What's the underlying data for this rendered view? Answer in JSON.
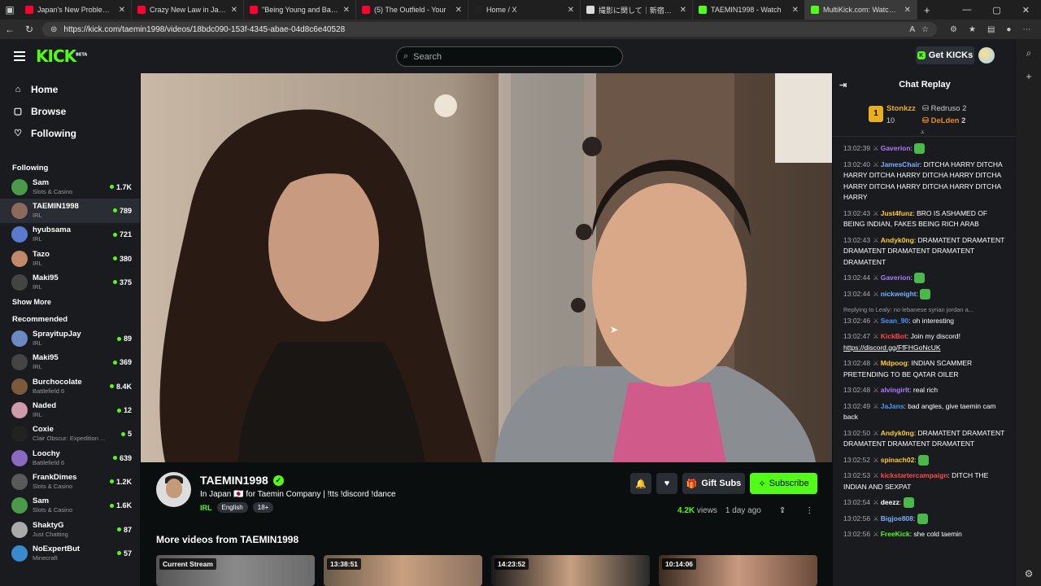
{
  "browser": {
    "tabs": [
      {
        "title": "Japan's New Problem: Zom",
        "color": "#ff0033",
        "active": false
      },
      {
        "title": "Crazy New Law in Japan to",
        "color": "#ff0033",
        "active": false
      },
      {
        "title": "\"Being Young and Based in",
        "color": "#ff0033",
        "active": false
      },
      {
        "title": "(5) The Outfield - Your",
        "color": "#ff0033",
        "active": false
      },
      {
        "title": "Home / X",
        "color": "#222222",
        "active": false
      },
      {
        "title": "撮影に関して｜新宿ゴールデン",
        "color": "#dddddd",
        "active": false
      },
      {
        "title": "TAEMIN1998 - Watch",
        "color": "#53fc18",
        "active": false
      },
      {
        "title": "MultiKick.com: Watch Mult",
        "color": "#53fc18",
        "active": true
      }
    ],
    "new_tab": "+",
    "url": "https://kick.com/taemin1998/videos/18bdc090-153f-4345-abae-04d8c6e40528"
  },
  "header": {
    "logo": "KICK",
    "logo_badge": "BETA",
    "search_placeholder": "Search",
    "get_kicks": "Get KICKs"
  },
  "sidebar": {
    "nav": [
      {
        "label": "Home",
        "icon": "⌂"
      },
      {
        "label": "Browse",
        "icon": "▢"
      },
      {
        "label": "Following",
        "icon": "♡"
      }
    ],
    "following_title": "Following",
    "following": [
      {
        "name": "Sam",
        "game": "Slots & Casino",
        "viewers": "1.7K",
        "color": "#4a9a4a"
      },
      {
        "name": "TAEMIN1998",
        "game": "IRL",
        "viewers": "789",
        "color": "#8a6a5a",
        "active": true
      },
      {
        "name": "hyubsama",
        "game": "IRL",
        "viewers": "721",
        "color": "#5a7ad0"
      },
      {
        "name": "Tazo",
        "game": "IRL",
        "viewers": "380",
        "color": "#c08a6a"
      },
      {
        "name": "Maki95",
        "game": "IRL",
        "viewers": "375",
        "color": "#444444"
      }
    ],
    "show_more": "Show More",
    "recommended_title": "Recommended",
    "recommended": [
      {
        "name": "SprayitupJay",
        "game": "IRL",
        "viewers": "89",
        "color": "#6a8ac0"
      },
      {
        "name": "Maki95",
        "game": "IRL",
        "viewers": "369",
        "color": "#444444"
      },
      {
        "name": "Burchocolate",
        "game": "Battlefield 6",
        "viewers": "8.4K",
        "color": "#7a5a3a"
      },
      {
        "name": "Naded",
        "game": "IRL",
        "viewers": "12",
        "color": "#d09aaa"
      },
      {
        "name": "Coxie",
        "game": "Clair Obscur: Expedition ...",
        "viewers": "5",
        "color": "#222222"
      },
      {
        "name": "Loochy",
        "game": "Battlefield 6",
        "viewers": "639",
        "color": "#8a6ac0"
      },
      {
        "name": "FrankDimes",
        "game": "Slots & Casino",
        "viewers": "1.2K",
        "color": "#5a5a5a"
      },
      {
        "name": "Sam",
        "game": "Slots & Casino",
        "viewers": "1.6K",
        "color": "#4a9a4a"
      },
      {
        "name": "ShaktyG",
        "game": "Just Chatting",
        "viewers": "87",
        "color": "#aaaaaa"
      },
      {
        "name": "NoExpertBut",
        "game": "Minecraft",
        "viewers": "57",
        "color": "#3a8ad0"
      }
    ]
  },
  "stream": {
    "name": "TAEMIN1998",
    "title": "In Japan 🇯🇵 for Taemin Company | !tts !discord !dance",
    "category": "IRL",
    "tags": [
      "English",
      "18+"
    ],
    "gift_subs": "Gift Subs",
    "subscribe": "Subscribe",
    "views": "4.2K",
    "views_label": "views",
    "ago": "1 day ago",
    "more_videos": "More videos from TAEMIN1998",
    "thumbs": [
      "Current Stream",
      "13:38:51",
      "14:23:52",
      "10:14:06"
    ]
  },
  "chat": {
    "title": "Chat Replay",
    "pinned": {
      "top_name": "Stonkzz",
      "top_count": "10",
      "r1_name": "Redruso",
      "r1_count": "2",
      "r2_name": "DeLden",
      "r2_count": "2"
    },
    "messages": [
      {
        "time": "13:02:39",
        "user": "Gaverion",
        "color": "#b07aff",
        "text": ""
      },
      {
        "time": "13:02:40",
        "user": "JamesChair",
        "color": "#7ab0ff",
        "text": "DITCHA HARRY DITCHA HARRY DITCHA HARRY DITCHA HARRY DITCHA HARRY DITCHA HARRY DITCHA HARRY DITCHA HARRY"
      },
      {
        "time": "13:02:43",
        "user": "Just4funz",
        "color": "#ffcc33",
        "text": "BRO IS ASHAMED OF BEING INDIAN, FAKES BEING RICH ARAB"
      },
      {
        "time": "13:02:43",
        "user": "Andyk0ng",
        "color": "#ffcc33",
        "text": "DRAMATENT DRAMATENT DRAMATENT DRAMATENT DRAMATENT DRAMATENT"
      },
      {
        "time": "13:02:44",
        "user": "Gaverion",
        "color": "#b07aff",
        "text": ""
      },
      {
        "time": "13:02:44",
        "user": "nickweight",
        "color": "#7ab0ff",
        "text": ""
      },
      {
        "time": "13:02:46",
        "user": "Sean_90",
        "color": "#4a9aff",
        "text": "oh interesting",
        "reply": "Replying to Lealy: no lebanese syrian jordan a..."
      },
      {
        "time": "13:02:47",
        "user": "KickBot",
        "color": "#ff4a4a",
        "text": "Join my discord!",
        "link": "https://discord.gg/FfFHGoNcUK"
      },
      {
        "time": "13:02:48",
        "user": "Mdpoog",
        "color": "#ffcc33",
        "text": "INDIAN SCAMMER PRETENDING TO BE QATAR OILER"
      },
      {
        "time": "13:02:48",
        "user": "alvingirlt",
        "color": "#b07aff",
        "text": "real rich"
      },
      {
        "time": "13:02:49",
        "user": "JaJans",
        "color": "#4a9aff",
        "text": "bad angles, give taemin cam back"
      },
      {
        "time": "13:02:50",
        "user": "Andyk0ng",
        "color": "#ffcc33",
        "text": "DRAMATENT DRAMATENT DRAMATENT DRAMATENT DRAMATENT"
      },
      {
        "time": "13:02:52",
        "user": "spinach02",
        "color": "#ffcc33",
        "text": ""
      },
      {
        "time": "13:02:53",
        "user": "kickstartercampaign",
        "color": "#ff4a4a",
        "text": "DITCH THE INDIAN AND SEXPAT"
      },
      {
        "time": "13:02:54",
        "user": "deezz",
        "color": "#ffffff",
        "text": ""
      },
      {
        "time": "13:02:56",
        "user": "Bigjoe808",
        "color": "#7ab0ff",
        "text": ""
      },
      {
        "time": "13:02:56",
        "user": "FreeKick",
        "color": "#53fc18",
        "text": "she cold taemin"
      }
    ]
  },
  "colors": {
    "accent": "#53fc18",
    "bg": "#0b0e0f",
    "panel": "#191b1f"
  }
}
